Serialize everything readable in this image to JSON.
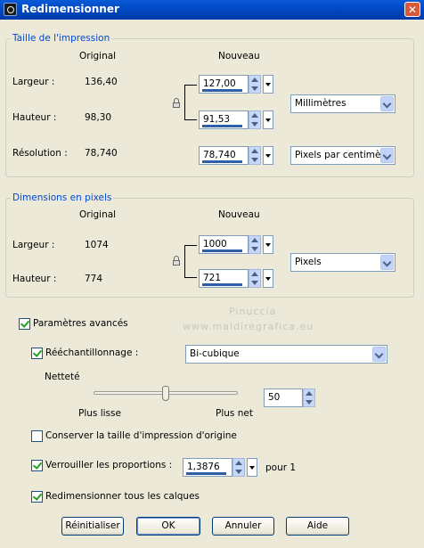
{
  "window": {
    "title": "Redimensionner",
    "close_glyph": "✕"
  },
  "print_size": {
    "legend": "Taille de l'impression",
    "col_original": "Original",
    "col_new": "Nouveau",
    "width_label": "Largeur :",
    "width_original": "136,40",
    "width_new": "127,00",
    "height_label": "Hauteur :",
    "height_original": "98,30",
    "height_new": "91,53",
    "unit": "Millimètres",
    "resolution_label": "Résolution :",
    "resolution_original": "78,740",
    "resolution_new": "78,740",
    "resolution_unit": "Pixels par centimètre"
  },
  "pixel_dims": {
    "legend": "Dimensions en pixels",
    "col_original": "Original",
    "col_new": "Nouveau",
    "width_label": "Largeur :",
    "width_original": "1074",
    "width_new": "1000",
    "height_label": "Hauteur :",
    "height_original": "774",
    "height_new": "721",
    "unit": "Pixels"
  },
  "watermark": {
    "line1": "Pinuccia",
    "line2": "www.maldiregrafica.eu"
  },
  "advanced": {
    "label": "Paramètres avancés",
    "checked": true,
    "resample_label": "Rééchantillonnage :",
    "resample_checked": true,
    "resample_method": "Bi-cubique",
    "sharpness_label": "Netteté",
    "sharpness_value": "50",
    "sharpness_level": 0.5,
    "smoother_label": "Plus lisse",
    "sharper_label": "Plus net",
    "keep_print_label": "Conserver la taille d'impression d'origine",
    "keep_print_checked": false,
    "lock_ratio_label": "Verrouiller les proportions :",
    "lock_ratio_checked": true,
    "ratio_value": "1,3876",
    "ratio_suffix": "pour 1",
    "resize_layers_label": "Redimensionner tous les calques",
    "resize_layers_checked": true
  },
  "buttons": {
    "reset": "Réinitialiser",
    "ok": "OK",
    "cancel": "Annuler",
    "help": "Aide"
  },
  "icons": [
    "app-icon",
    "close-icon",
    "lock-icon",
    "spin-up-icon",
    "spin-down-icon",
    "dropdown-arrow-icon",
    "checkmark-icon"
  ]
}
